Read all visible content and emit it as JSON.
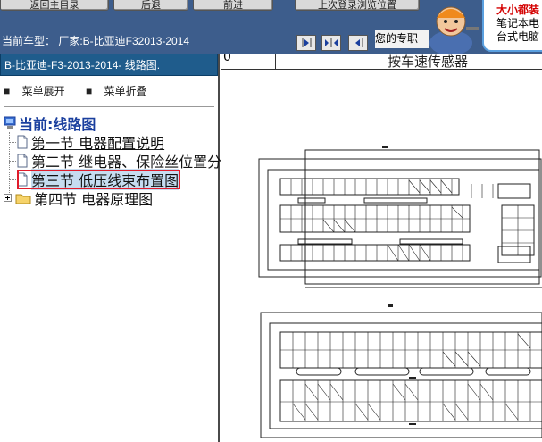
{
  "toolbar": {
    "buttons": [
      "返回主目录",
      "后退",
      "前进",
      "上次登录浏览位置"
    ]
  },
  "status": {
    "car_model": "当前车型：  厂家:B-比亚迪F32013-2014",
    "ticker": "您的专职"
  },
  "ad": {
    "line1": "大小都装",
    "line2": "笔记本电",
    "line3": "台式电脑"
  },
  "tree": {
    "header": "B-比亚迪-F3-2013-2014- 线路图.",
    "expand_label": "菜单展开",
    "collapse_label": "菜单折叠",
    "root_label": "当前:线路图",
    "items": [
      "第一节 电器配置说明",
      "第二节 继电器、保险丝位置分布图",
      "第三节 低压线束布置图",
      "第四节 电器原理图"
    ]
  },
  "content": {
    "title": "按车速传感器",
    "corner_mark": "0"
  },
  "colors": {
    "header_bg": "#1f5c8c",
    "toolbar_bg": "#3d5d8c",
    "highlight": "#e11b2b"
  }
}
